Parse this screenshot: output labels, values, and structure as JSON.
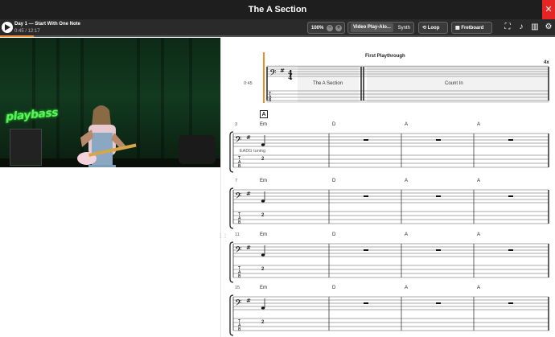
{
  "window": {
    "title": "The A Section",
    "close_icon": "close-icon"
  },
  "toolbar": {
    "lesson_title": "Day 1 — Start With One Note",
    "lesson_time": "0:45 / 12:17",
    "progress_fraction": 0.061,
    "zoom": "100%",
    "mode_selected": "Video Play-Alo...",
    "mode_alt": "Synth",
    "loop_label": "Loop",
    "fretboard_label": "Fretboard",
    "accent_color": "#f08a2a"
  },
  "video": {
    "logo_text": "playbass"
  },
  "notation": {
    "first_system": {
      "title": "First Playthrough",
      "repeat": "4x",
      "time": "0:45",
      "blocks": [
        "The A Section",
        "Count In"
      ]
    },
    "section_marker": "A",
    "tuning_text": "EADG tuning",
    "systems": [
      {
        "bar_number": "3",
        "chords": [
          "Em",
          "D",
          "A",
          "A"
        ],
        "tab_note": "2"
      },
      {
        "bar_number": "7",
        "chords": [
          "Em",
          "D",
          "A",
          "A"
        ],
        "tab_note": "2"
      },
      {
        "bar_number": "11",
        "chords": [
          "Em",
          "D",
          "A",
          "A"
        ],
        "tab_note": "2"
      },
      {
        "bar_number": "15",
        "chords": [
          "Em",
          "D",
          "A",
          "A"
        ],
        "tab_note": "2"
      }
    ]
  }
}
